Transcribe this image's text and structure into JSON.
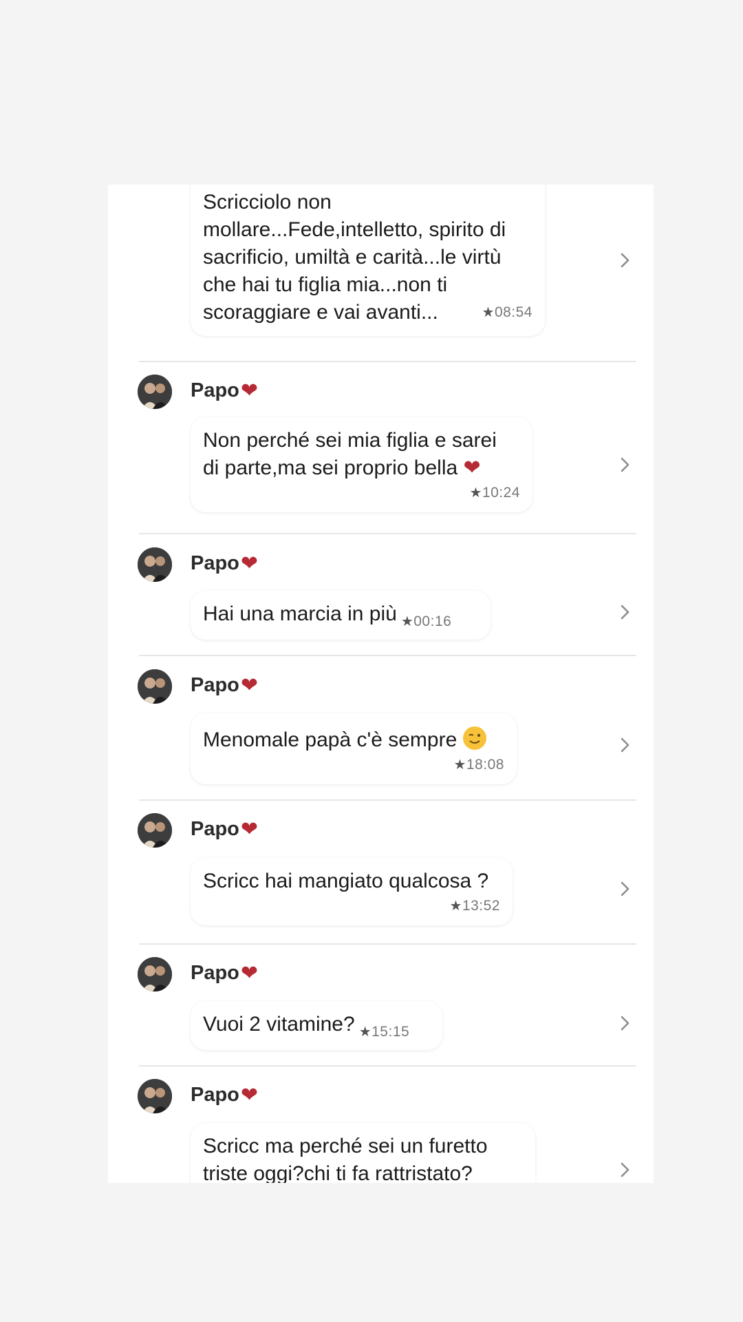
{
  "sender_name": "Papo",
  "messages": [
    {
      "text": "Scricciolo non mollare...Fede,intelletto, spirito di sacrificio, umiltà e carità...le virtù che hai tu figlia mia...non ti scoraggiare e vai avanti...",
      "lines": [
        "Scricciolo non",
        "mollare...Fede,intelletto, spirito di",
        "sacrificio, umiltà e carità...le virtù",
        "che hai tu figlia mia...non ti",
        "scoraggiare e vai avanti..."
      ],
      "time": "08:54"
    },
    {
      "lines": [
        "Non perché sei mia figlia e sarei",
        "di parte,ma sei proprio bella"
      ],
      "time": "10:24"
    },
    {
      "lines": [
        "Hai una marcia in più"
      ],
      "time": "00:16"
    },
    {
      "lines": [
        "Menomale papà c'è sempre"
      ],
      "time": "18:08"
    },
    {
      "lines": [
        "Scricc hai mangiato qualcosa ?"
      ],
      "time": "13:52"
    },
    {
      "lines": [
        "Vuoi 2 vitamine?"
      ],
      "time": "15:15"
    },
    {
      "lines": [
        "Scricc ma perché sei un furetto",
        "triste oggi?chi ti fa rattristato?"
      ],
      "time": ""
    }
  ],
  "icons": {
    "star": "star-icon",
    "chevron": "chevron-right-icon",
    "heart": "red-heart-emoji",
    "wink": "winking-face-emoji"
  },
  "colors": {
    "heart": "#b62a35",
    "background": "#f4f4f4",
    "panel": "#ffffff"
  }
}
